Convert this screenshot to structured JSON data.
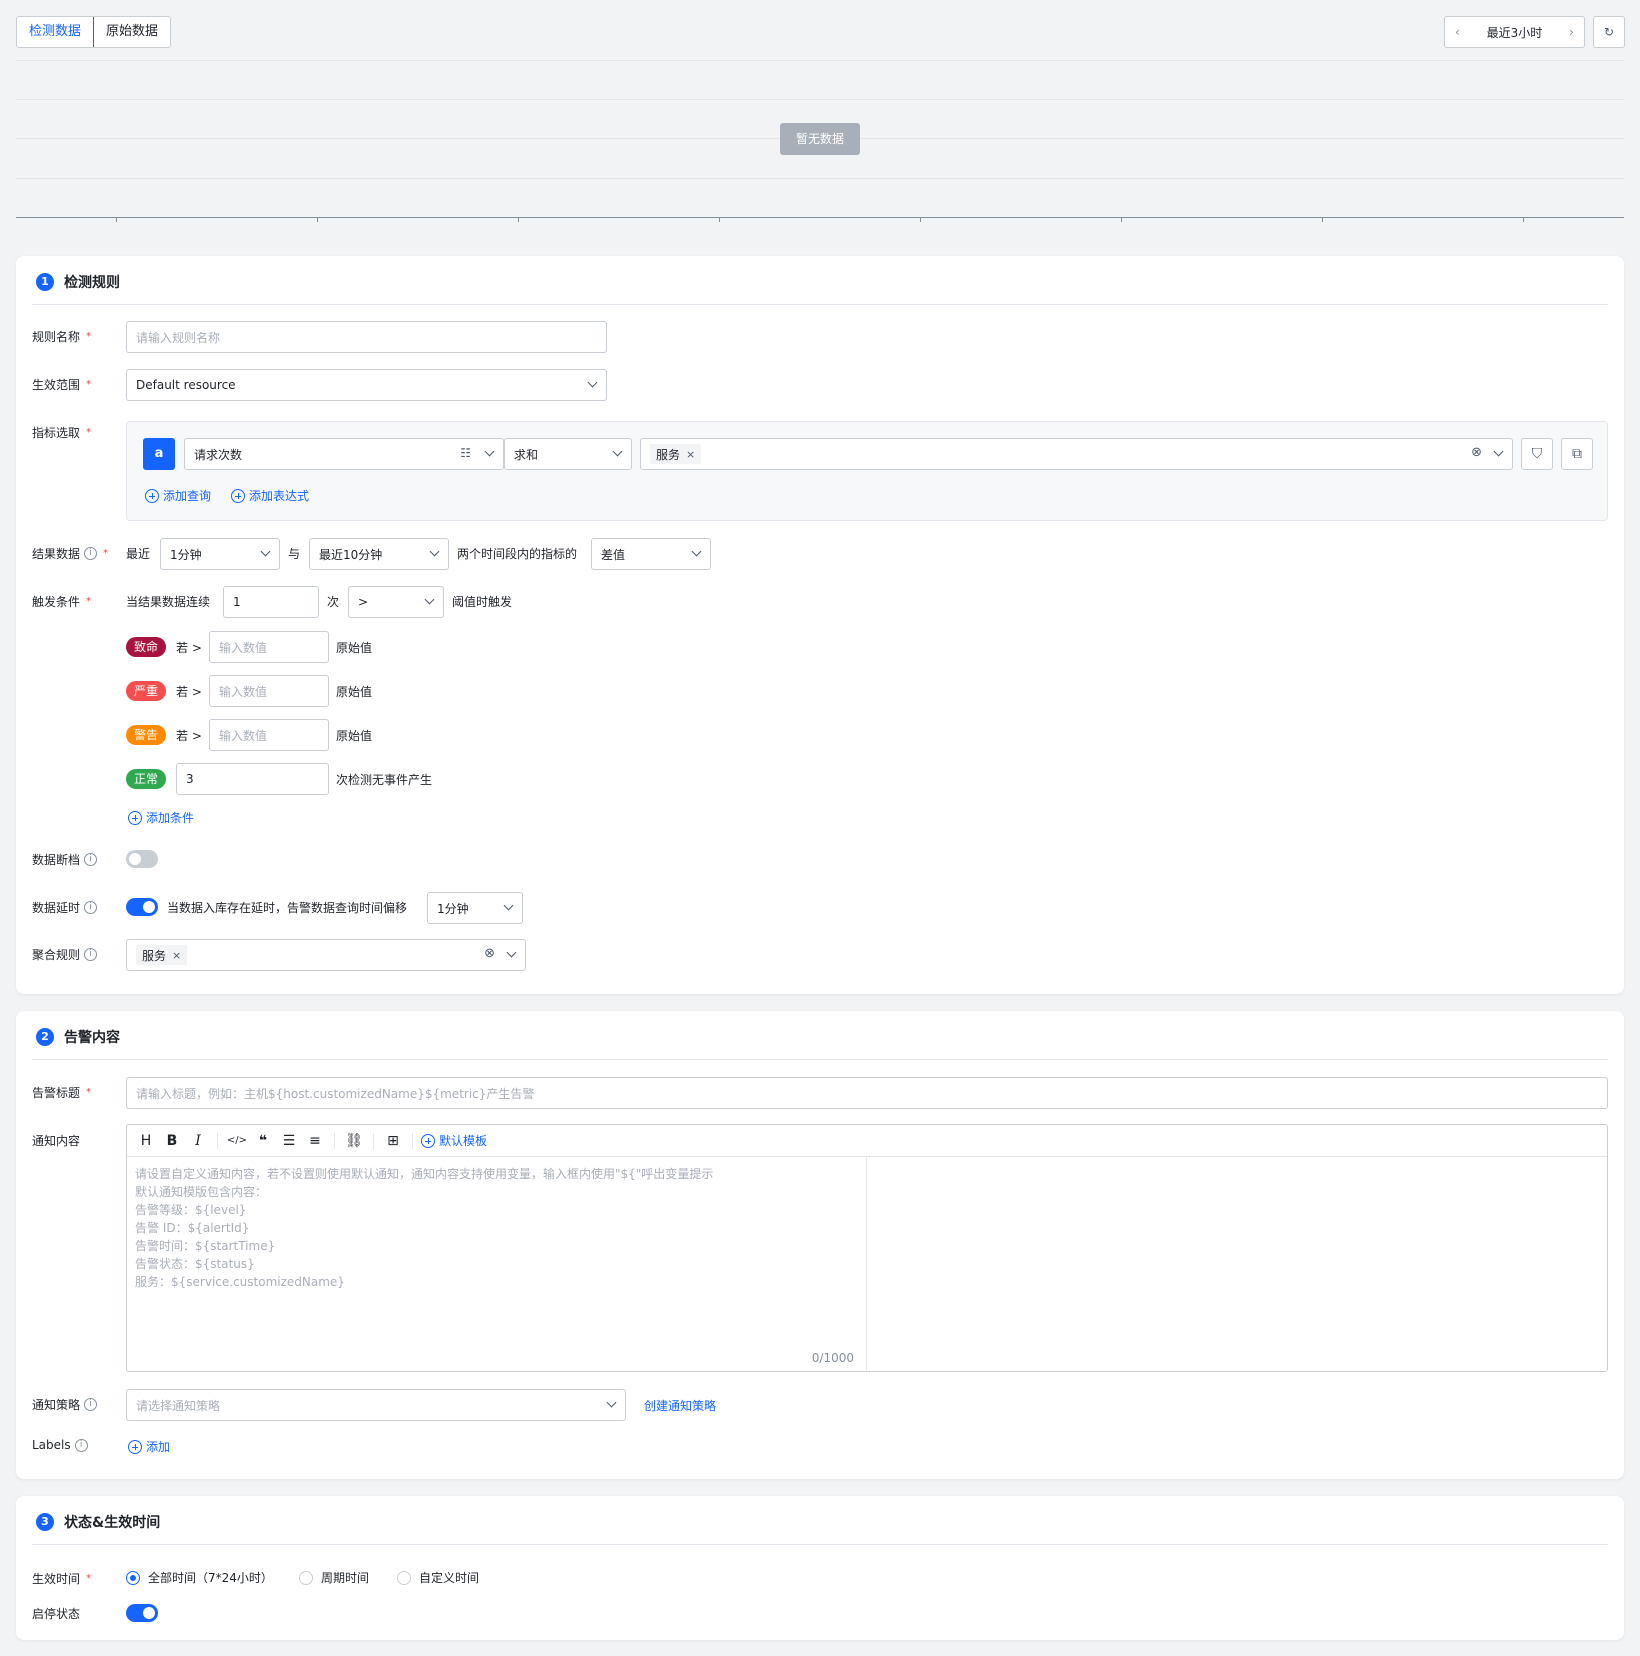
{
  "tabs": [
    "检测数据",
    "原始数据"
  ],
  "time_range": "最近3小时",
  "chart": {
    "empty_text": "暂无数据"
  },
  "colors": {
    "primary": "#1664ff",
    "fatal": "#a8123e",
    "severe": "#f54e4e",
    "warn": "#ff8a00",
    "normal": "#2fa84f"
  },
  "section1": {
    "num": "1",
    "title": "检测规则",
    "rule_name": {
      "label": "规则名称",
      "placeholder": "请输入规则名称"
    },
    "scope": {
      "label": "生效范围",
      "value": "Default resource"
    },
    "metric": {
      "label": "指标选取",
      "badge": "a",
      "metric_value": "请求次数",
      "agg": "求和",
      "group_tag": "服务",
      "add_query": "添加查询",
      "add_expr": "添加表达式"
    },
    "result": {
      "label": "结果数据",
      "recent": "最近",
      "period1": "1分钟",
      "with": "与",
      "period2": "最近10分钟",
      "between": "两个时间段内的指标的",
      "method": "差值"
    },
    "trigger": {
      "label": "触发条件",
      "prefix": "当结果数据连续",
      "count": "1",
      "times": "次",
      "op": ">",
      "suffix": "阈值时触发",
      "if_gt": "若 >",
      "input_ph": "输入数值",
      "raw": "原始值",
      "levels": [
        "致命",
        "严重",
        "警告"
      ],
      "normal": {
        "tag": "正常",
        "value": "3",
        "suffix": "次检测无事件产生"
      },
      "add_condition": "添加条件"
    },
    "gap": {
      "label": "数据断档"
    },
    "delay": {
      "label": "数据延时",
      "desc": "当数据入库存在延时，告警数据查询时间偏移",
      "value": "1分钟"
    },
    "aggregate": {
      "label": "聚合规则",
      "tag": "服务"
    }
  },
  "section2": {
    "num": "2",
    "title": "告警内容",
    "alert_title": {
      "label": "告警标题",
      "placeholder": "请输入标题，例如：主机${host.customizedName}${metric}产生告警"
    },
    "notify": {
      "label": "通知内容",
      "default_template": "默认模板",
      "placeholder_lines": [
        "请设置自定义通知内容，若不设置则使用默认通知，通知内容支持使用变量，输入框内使用\"${\"呼出变量提示",
        "默认通知模版包含内容：",
        "告警等级：${level}",
        "告警 ID：${alertId}",
        "告警时间：${startTime}",
        "告警状态：${status}",
        "服务：${service.customizedName}"
      ],
      "counter": "0/1000"
    },
    "policy": {
      "label": "通知策略",
      "placeholder": "请选择通知策略",
      "create": "创建通知策略"
    },
    "labels": {
      "label": "Labels",
      "add": "添加"
    }
  },
  "section3": {
    "num": "3",
    "title": "状态&生效时间",
    "effective": {
      "label": "生效时间",
      "options": [
        "全部时间（7*24小时）",
        "周期时间",
        "自定义时间"
      ]
    },
    "status": {
      "label": "启停状态"
    }
  }
}
